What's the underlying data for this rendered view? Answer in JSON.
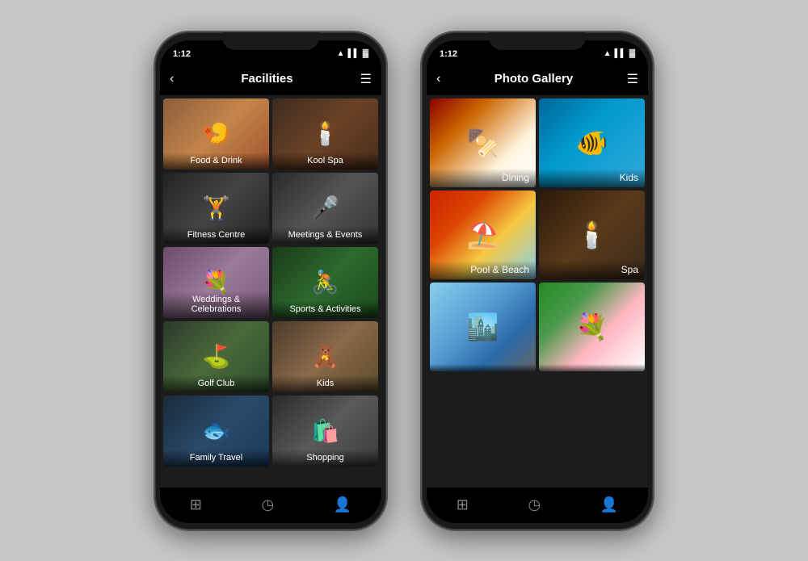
{
  "phone1": {
    "statusBar": {
      "time": "1:12",
      "icons": "▲ ▌▌ 🔋"
    },
    "header": {
      "title": "Facilities",
      "backLabel": "‹",
      "menuLabel": "☰"
    },
    "tiles": [
      {
        "id": "food-drink",
        "label": "Food & Drink",
        "colorClass": "food-drink",
        "icon": "🍤"
      },
      {
        "id": "kool-spa",
        "label": "Kool Spa",
        "colorClass": "kool-spa",
        "icon": "🕯️"
      },
      {
        "id": "fitness",
        "label": "Fitness Centre",
        "colorClass": "fitness",
        "icon": "🏋️"
      },
      {
        "id": "meetings",
        "label": "Meetings & Events",
        "colorClass": "meetings",
        "icon": "🎤"
      },
      {
        "id": "weddings",
        "label": "Weddings & Celebrations",
        "colorClass": "weddings",
        "icon": "💐"
      },
      {
        "id": "sports",
        "label": "Sports & Activities",
        "colorClass": "sports",
        "icon": "🚴"
      },
      {
        "id": "golf",
        "label": "Golf Club",
        "colorClass": "golf",
        "icon": "⛳"
      },
      {
        "id": "kids",
        "label": "Kids",
        "colorClass": "kids-tile",
        "icon": "🧸"
      },
      {
        "id": "family",
        "label": "Family Travel",
        "colorClass": "family",
        "icon": "🐟"
      },
      {
        "id": "shopping",
        "label": "Shopping",
        "colorClass": "shopping",
        "icon": "🛍️"
      }
    ],
    "bottomNav": [
      "⊞",
      "◷",
      "👤"
    ]
  },
  "phone2": {
    "statusBar": {
      "time": "1:12",
      "icons": "▲ ▌▌ 🔋"
    },
    "header": {
      "title": "Photo Gallery",
      "backLabel": "‹",
      "menuLabel": "☰"
    },
    "gallery": [
      {
        "id": "dining",
        "label": "Dining",
        "colorClass": "dining-photo",
        "icon": "🍢"
      },
      {
        "id": "kids",
        "label": "Kids",
        "colorClass": "kids-photo",
        "icon": "🐠"
      },
      {
        "id": "pool",
        "label": "Pool & Beach",
        "colorClass": "pool-photo",
        "icon": "⛱️"
      },
      {
        "id": "spa",
        "label": "Spa",
        "colorClass": "spa-photo",
        "icon": "🕯️"
      },
      {
        "id": "city",
        "label": "",
        "colorClass": "city-photo",
        "icon": "🏙️"
      },
      {
        "id": "flowers",
        "label": "",
        "colorClass": "flowers-photo",
        "icon": "💐"
      }
    ],
    "bottomNav": [
      "⊞",
      "◷",
      "👤"
    ]
  }
}
